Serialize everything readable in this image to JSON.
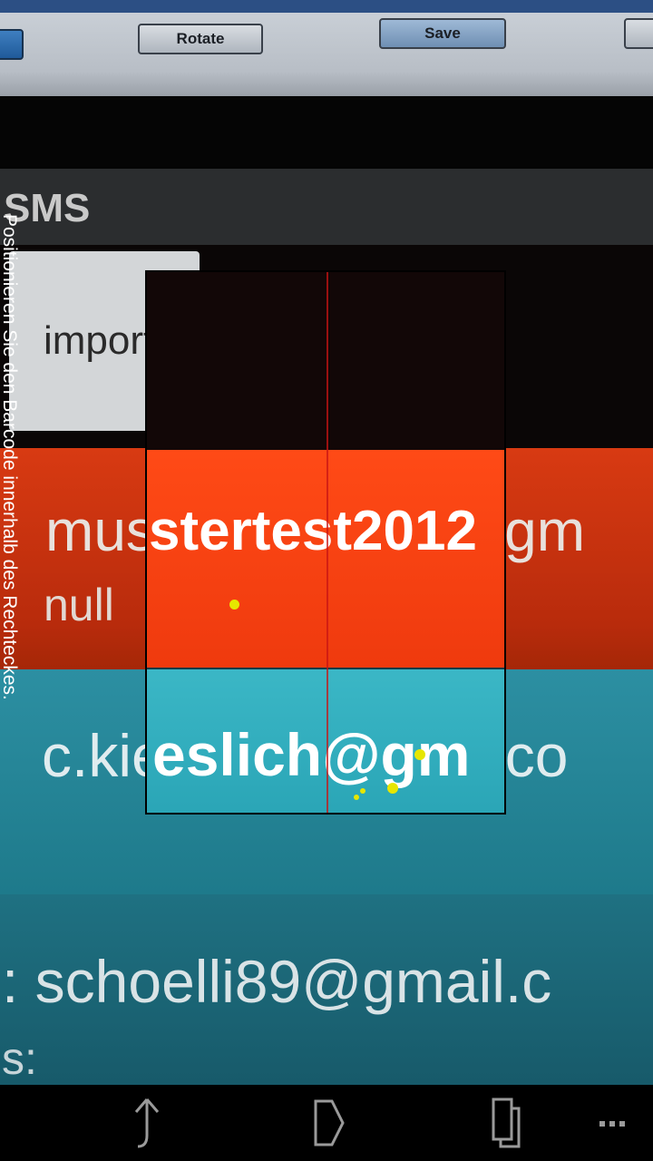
{
  "toolbar": {
    "rotate_label": "Rotate",
    "save_label": "Save"
  },
  "app": {
    "title": "SMS",
    "import_label": "import"
  },
  "rows": [
    {
      "email": "mustertest2012@gm",
      "status": "null"
    },
    {
      "email": "c.kieslich@gmail.co"
    },
    {
      "email": ": schoelli89@gmail.c",
      "trailing": "s:"
    }
  ],
  "scanner": {
    "hint": "Positionieren Sie den Barcode innerhalb des Rechteckes.",
    "frame_text_1": "stertest2012",
    "frame_text_2": "eslich@gm"
  },
  "action_bar": {
    "icons": [
      "share-icon",
      "forward-icon",
      "copy-icon",
      "overflow-menu-icon"
    ]
  },
  "colors": {
    "orange_row": "#d83a12",
    "teal_row": "#2c8fa2",
    "result_point": "#e6e600"
  }
}
